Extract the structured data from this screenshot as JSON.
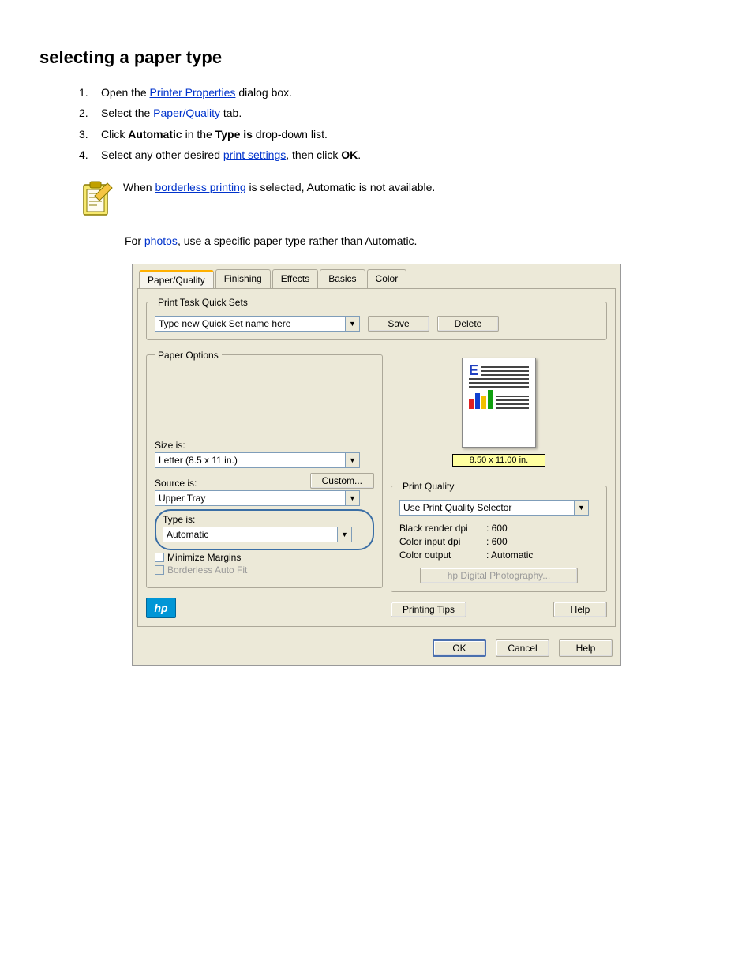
{
  "section_title": "selecting a paper type",
  "instructions": [
    {
      "n": "1.",
      "text_a": "Open the ",
      "link": "Printer Properties",
      "text_b": " dialog box."
    },
    {
      "n": "2.",
      "text_a": "Select the ",
      "link": "Paper/Quality",
      "text_b": " tab."
    },
    {
      "n": "3.",
      "text_a": "Click ",
      "bold": "Automatic",
      "text_b": " in the ",
      "bold2": "Type is",
      "text_c": " drop-down list."
    },
    {
      "n": "4.",
      "text_a": "Select any other desired ",
      "link": "print settings",
      "text_b": ", then click ",
      "bold": "OK",
      "text_c": "."
    }
  ],
  "note": {
    "line1_a": "When ",
    "link1": "borderless printing",
    "line1_b": " is selected, Automatic is not available.",
    "line2_a": "For ",
    "link2": "photos",
    "line2_b": ", use a specific paper type rather than Automatic."
  },
  "dialog": {
    "tabs": [
      "Paper/Quality",
      "Finishing",
      "Effects",
      "Basics",
      "Color"
    ],
    "quicksets": {
      "legend": "Print Task Quick Sets",
      "value": "Type new Quick Set name here",
      "save": "Save",
      "delete": "Delete"
    },
    "paper_options": {
      "legend": "Paper Options",
      "size_label": "Size is:",
      "size_value": "Letter (8.5 x 11 in.)",
      "custom": "Custom...",
      "source_label": "Source is:",
      "source_value": "Upper Tray",
      "type_label": "Type is:",
      "type_value": "Automatic",
      "minimize_margins": "Minimize Margins",
      "borderless_auto_fit": "Borderless Auto Fit"
    },
    "preview_badge": "8.50 x 11.00 in.",
    "print_quality": {
      "legend": "Print Quality",
      "value": "Use Print Quality Selector",
      "black_k": "Black render dpi",
      "black_v": ": 600",
      "color_in_k": "Color input dpi",
      "color_in_v": ": 600",
      "color_out_k": "Color output",
      "color_out_v": ": Automatic",
      "hp_digital": "hp Digital Photography..."
    },
    "printing_tips": "Printing Tips",
    "help_inner": "Help",
    "ok": "OK",
    "cancel": "Cancel",
    "help": "Help"
  }
}
